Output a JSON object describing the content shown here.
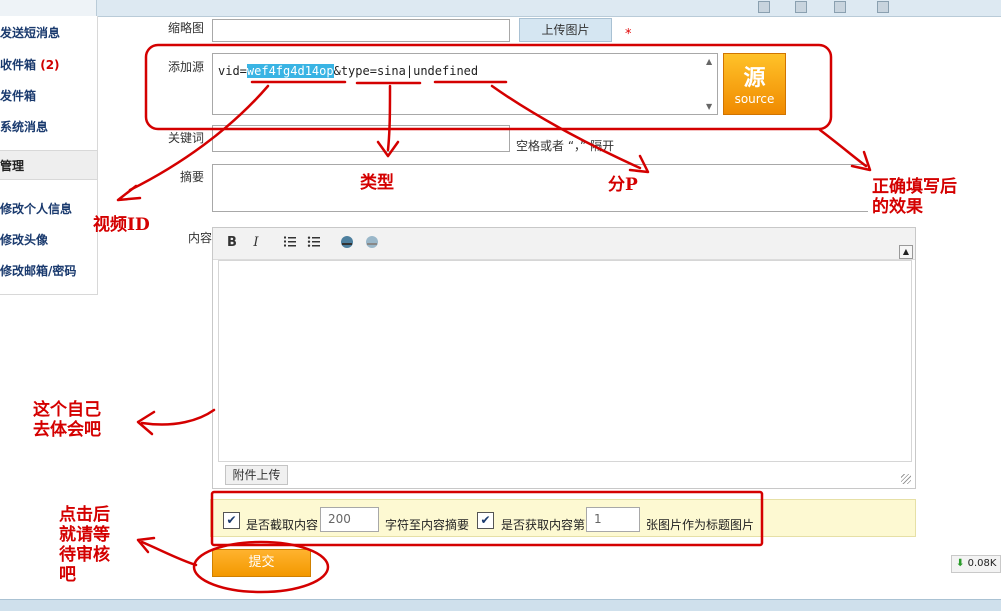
{
  "sidebar": {
    "items_top": [
      "发送短消息",
      "收件箱",
      "发件箱",
      "系统消息"
    ],
    "inbox_count": "(2)",
    "section_head": "管理",
    "items_bottom": [
      "修改个人信息",
      "修改头像",
      "修改邮箱/密码"
    ]
  },
  "form": {
    "thumb_label": "缩略图",
    "upload_button": "上传图片",
    "required_star": "*",
    "source_label": "添加源",
    "source_value": {
      "prefix": "vid=",
      "vid": "wef4fg4d14op",
      "type_part": "&type=sina",
      "sep": "|",
      "part": "undefined"
    },
    "source_button_big": "源",
    "source_button_small": "source",
    "keywords_label": "关键词",
    "keywords_hint": "空格或者 “，” 隔开",
    "summary_label": "摘要",
    "content_label": "内容",
    "toolbar": {
      "bold": "B",
      "italic": "I"
    },
    "attach_button": "附件上传",
    "options": {
      "cut_label": "是否截取内容",
      "cut_value": "200",
      "cut_suffix": "字符至内容摘要",
      "img_label": "是否获取内容第",
      "img_value": "1",
      "img_suffix": "张图片作为标题图片"
    },
    "submit_button": "提交"
  },
  "annotations": {
    "video_id": "视频ID",
    "type": "类型",
    "part": "分P",
    "result": [
      "正确填写后",
      "的效果"
    ],
    "editor_note": [
      "这个自己",
      "去体会吧"
    ],
    "submit_note": [
      "点击后",
      "就请等",
      "待审核",
      "吧"
    ]
  },
  "download_badge": "0.08K",
  "colors": {
    "annotation_red": "#d40000",
    "highlight": "#39b4e4",
    "submit_orange": "#f39800"
  }
}
